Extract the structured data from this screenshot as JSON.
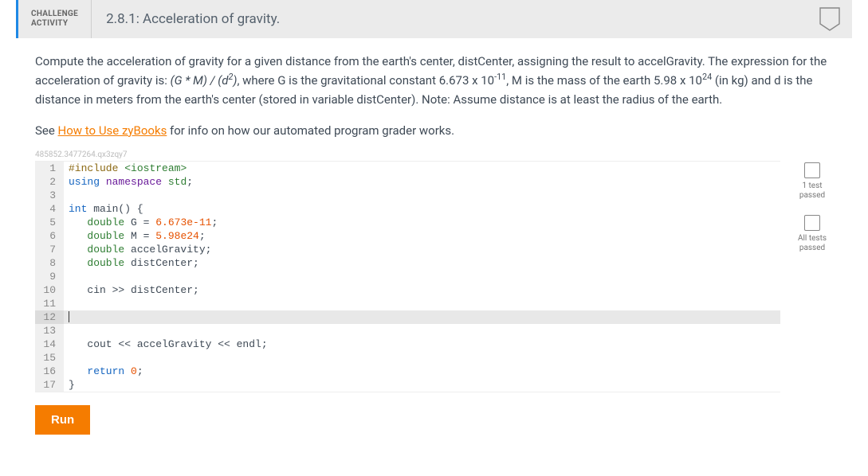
{
  "header": {
    "label_line1": "CHALLENGE",
    "label_line2": "ACTIVITY",
    "title": "2.8.1: Acceleration of gravity."
  },
  "instructions_html": "Compute the acceleration of gravity for a given distance from the earth's center, distCenter, assigning the result to accelGravity. The expression for the acceleration of gravity is: <em>(G * M) / (d<sup>2</sup>)</em>, where G is the gravitational constant 6.673 x 10<sup>-11</sup>, M is the mass of the earth 5.98 x 10<sup>24</sup> (in kg) and d is the distance in meters from the earth's center (stored in variable distCenter). Note: Assume distance is at least the radius of the earth.",
  "see": {
    "prefix": "See ",
    "link": "How to Use zyBooks",
    "suffix": " for info on how our automated program grader works."
  },
  "watermark": "485852.3477264.qx3zqy7",
  "code": [
    {
      "n": 1,
      "html": "<span class='kw-pre'>#include</span> <span class='kw-inc'>&lt;iostream&gt;</span>"
    },
    {
      "n": 2,
      "html": "<span class='kw-blue'>using</span> <span class='kw-purple'>namespace</span> <span class='kw-std'>std</span>;"
    },
    {
      "n": 3,
      "html": ""
    },
    {
      "n": 4,
      "html": "<span class='kw-blue'>int</span> main() {"
    },
    {
      "n": 5,
      "html": "   <span class='kw-teal'>double</span> G = <span class='kw-num'>6.673e-11</span>;"
    },
    {
      "n": 6,
      "html": "   <span class='kw-teal'>double</span> M = <span class='kw-num'>5.98e24</span>;"
    },
    {
      "n": 7,
      "html": "   <span class='kw-teal'>double</span> accelGravity;"
    },
    {
      "n": 8,
      "html": "   <span class='kw-teal'>double</span> distCenter;"
    },
    {
      "n": 9,
      "html": ""
    },
    {
      "n": 10,
      "html": "   cin &gt;&gt; distCenter;"
    },
    {
      "n": 11,
      "html": ""
    },
    {
      "n": 12,
      "html": "<span class='cursor'></span>",
      "active": true
    },
    {
      "n": 13,
      "html": ""
    },
    {
      "n": 14,
      "html": "   cout &lt;&lt; accelGravity &lt;&lt; endl;"
    },
    {
      "n": 15,
      "html": ""
    },
    {
      "n": 16,
      "html": "   <span class='kw-blue'>return</span> <span class='kw-num'>0</span>;"
    },
    {
      "n": 17,
      "html": "}"
    }
  ],
  "status": [
    {
      "label_line1": "1 test",
      "label_line2": "passed"
    },
    {
      "label_line1": "All tests",
      "label_line2": "passed"
    }
  ],
  "run_label": "Run"
}
